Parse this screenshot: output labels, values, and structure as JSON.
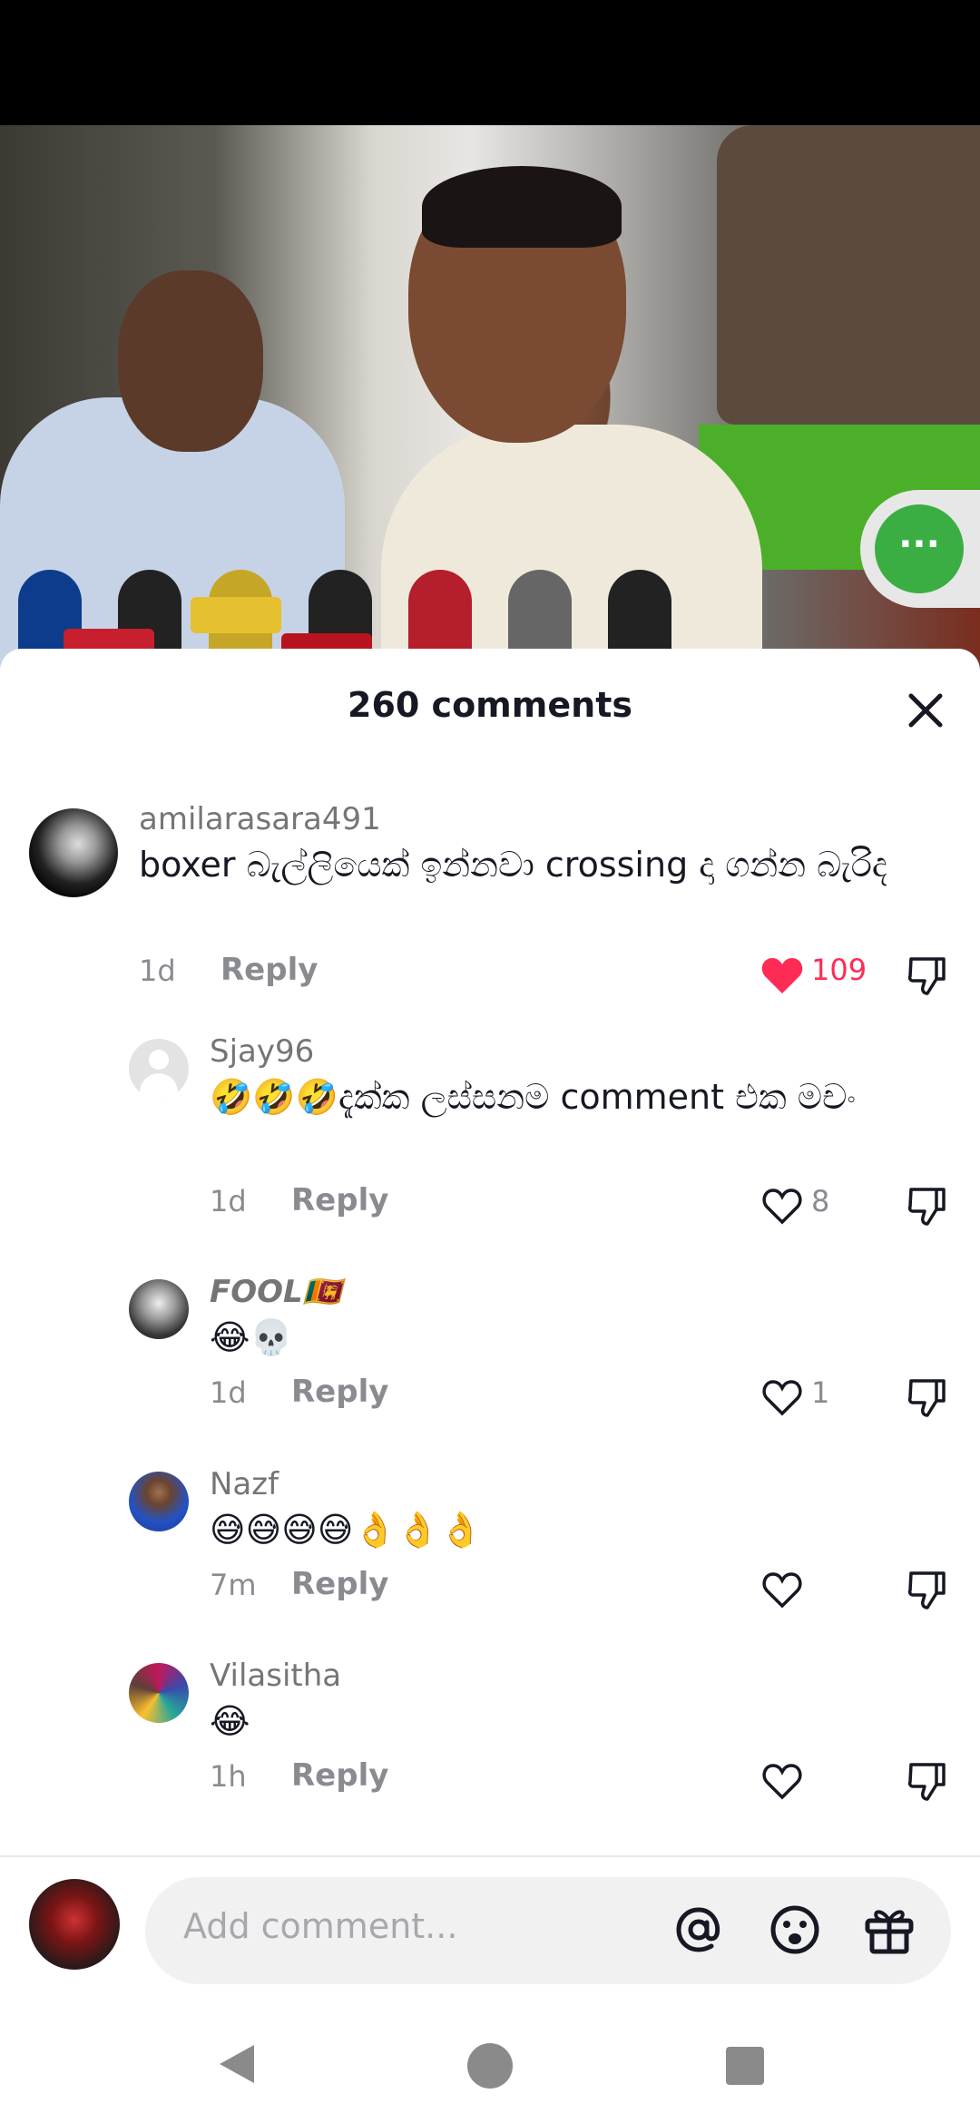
{
  "sheet": {
    "title": "260 comments"
  },
  "comments": [
    {
      "username": "amilarasara491",
      "text": "boxer බැල්ලියෙක් ඉන්නවා crossing දා ගන්න බැරිද",
      "time": "1d",
      "reply_label": "Reply",
      "likes": "109",
      "liked": true
    },
    {
      "username": "Sjay96",
      "text": "🤣🤣🤣දැක්ක ලස්සනම comment එක මචං",
      "time": "1d",
      "reply_label": "Reply",
      "likes": "8",
      "liked": false
    },
    {
      "username": "FOOL🇱🇰",
      "text": "😂💀",
      "time": "1d",
      "reply_label": "Reply",
      "likes": "1",
      "liked": false
    },
    {
      "username": "Nazf",
      "text": "😅😅😅😅👌👌👌",
      "time": "7m",
      "reply_label": "Reply",
      "likes": "",
      "liked": false
    },
    {
      "username": "Vilasitha",
      "text": "😂",
      "time": "1h",
      "reply_label": "Reply",
      "likes": "",
      "liked": false
    }
  ],
  "composer": {
    "placeholder": "Add comment..."
  },
  "icons": {
    "close": "close-icon",
    "more": "more-icon",
    "heart": "heart-icon",
    "dislike": "dislike-icon",
    "mention": "at-icon",
    "emoji": "emoji-icon",
    "gift": "gift-icon",
    "nav_back": "back-triangle-icon",
    "nav_home": "home-circle-icon",
    "nav_recents": "recents-square-icon"
  },
  "colors": {
    "like_red": "#fe2c55",
    "more_green": "#3bae43",
    "text_primary": "#161823",
    "text_secondary": "#8a8b91"
  }
}
